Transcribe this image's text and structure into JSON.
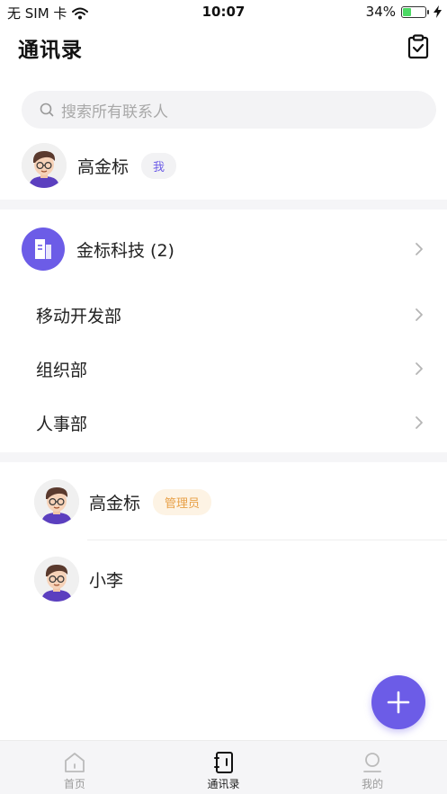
{
  "status_bar": {
    "carrier": "无 SIM 卡",
    "time": "10:07",
    "battery_text": "34%",
    "battery_level": 0.34
  },
  "header": {
    "title": "通讯录",
    "action_icon": "clipboard-check-icon"
  },
  "search": {
    "placeholder": "搜索所有联系人"
  },
  "me": {
    "name": "高金标",
    "tag": "我"
  },
  "company": {
    "name": "金标科技 (2)"
  },
  "departments": [
    {
      "name": "移动开发部"
    },
    {
      "name": "组织部"
    },
    {
      "name": "人事部"
    }
  ],
  "members": [
    {
      "name": "高金标",
      "tag": "管理员"
    },
    {
      "name": "小李",
      "tag": ""
    }
  ],
  "tab_bar": {
    "tabs": [
      {
        "label": "首页",
        "icon": "home-icon",
        "active": false
      },
      {
        "label": "通讯录",
        "icon": "contacts-book-icon",
        "active": true
      },
      {
        "label": "我的",
        "icon": "user-icon",
        "active": false
      }
    ]
  },
  "colors": {
    "accent": "#6c5ce7",
    "admin_tag_text": "#e8a047",
    "admin_tag_bg": "#fdf3e4",
    "battery_green": "#4cd964"
  }
}
